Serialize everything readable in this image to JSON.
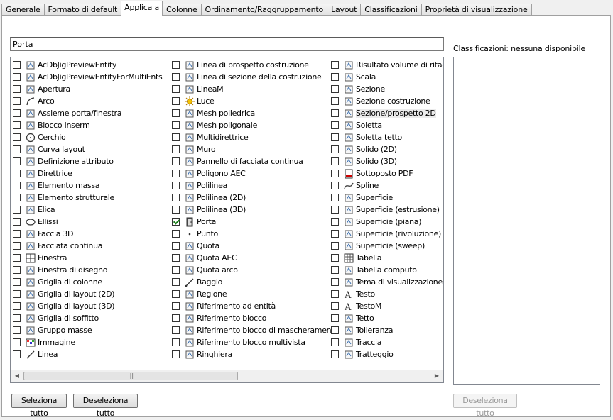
{
  "tabs": [
    {
      "label": "Generale"
    },
    {
      "label": "Formato di default"
    },
    {
      "label": "Applica a",
      "active": true
    },
    {
      "label": "Colonne"
    },
    {
      "label": "Ordinamento/Raggruppamento"
    },
    {
      "label": "Layout"
    },
    {
      "label": "Classificazioni"
    },
    {
      "label": "Proprietà di visualizzazione"
    }
  ],
  "filter": {
    "value": "Porta"
  },
  "classifications": {
    "label": "Classificazioni: nessuna disponibile"
  },
  "objects": {
    "col1": [
      {
        "label": "AcDbJigPreviewEntity",
        "icon": "document-icon"
      },
      {
        "label": "AcDbJigPreviewEntityForMultiEnts",
        "icon": "document-icon"
      },
      {
        "label": "Apertura",
        "icon": "opening-icon"
      },
      {
        "label": "Arco",
        "icon": "arc-icon"
      },
      {
        "label": "Assieme porta/finestra",
        "icon": "door-window-assembly-icon"
      },
      {
        "label": "Blocco Inserm",
        "icon": "block-icon"
      },
      {
        "label": "Cerchio",
        "icon": "circle-icon"
      },
      {
        "label": "Curva layout",
        "icon": "layout-curve-icon"
      },
      {
        "label": "Definizione attributo",
        "icon": "attribute-tag-icon"
      },
      {
        "label": "Direttrice",
        "icon": "direction-icon"
      },
      {
        "label": "Elemento massa",
        "icon": "mass-element-icon"
      },
      {
        "label": "Elemento strutturale",
        "icon": "structural-member-icon"
      },
      {
        "label": "Elica",
        "icon": "helix-icon"
      },
      {
        "label": "Ellissi",
        "icon": "ellipse-icon"
      },
      {
        "label": "Faccia 3D",
        "icon": "face-3d-icon"
      },
      {
        "label": "Facciata continua",
        "icon": "curtain-wall-icon"
      },
      {
        "label": "Finestra",
        "icon": "window-icon"
      },
      {
        "label": "Finestra di disegno",
        "icon": "viewport-icon"
      },
      {
        "label": "Griglia di colonne",
        "icon": "column-grid-icon"
      },
      {
        "label": "Griglia di layout (2D)",
        "icon": "grid-2d-icon"
      },
      {
        "label": "Griglia di layout (3D)",
        "icon": "grid-3d-icon"
      },
      {
        "label": "Griglia di soffitto",
        "icon": "ceiling-grid-icon"
      },
      {
        "label": "Gruppo masse",
        "icon": "mass-group-icon"
      },
      {
        "label": "Immagine",
        "icon": "image-icon"
      },
      {
        "label": "Linea",
        "icon": "line-icon"
      }
    ],
    "col2": [
      {
        "label": "Linea di prospetto costruzione",
        "icon": "elevation-line-icon"
      },
      {
        "label": "Linea di sezione della costruzione",
        "icon": "section-line-icon"
      },
      {
        "label": "LineaM",
        "icon": "mline-icon"
      },
      {
        "label": "Luce",
        "icon": "light-icon"
      },
      {
        "label": "Mesh poliedrica",
        "icon": "polyface-mesh-icon"
      },
      {
        "label": "Mesh poligonale",
        "icon": "polygon-mesh-icon"
      },
      {
        "label": "Multidirettrice",
        "icon": "multileader-icon"
      },
      {
        "label": "Muro",
        "icon": "wall-icon"
      },
      {
        "label": "Pannello di facciata continua",
        "icon": "curtain-panel-icon"
      },
      {
        "label": "Poligono AEC",
        "icon": "polygon-icon"
      },
      {
        "label": "Polilinea",
        "icon": "polyline-icon"
      },
      {
        "label": "Polilinea (2D)",
        "icon": "polyline-2d-icon"
      },
      {
        "label": "Polilinea (3D)",
        "icon": "polyline-3d-icon"
      },
      {
        "label": "Porta",
        "icon": "door-icon",
        "checked": true
      },
      {
        "label": "Punto",
        "icon": "point-icon"
      },
      {
        "label": "Quota",
        "icon": "dimension-icon"
      },
      {
        "label": "Quota AEC",
        "icon": "aec-dimension-icon"
      },
      {
        "label": "Quota arco",
        "icon": "arc-dimension-icon"
      },
      {
        "label": "Raggio",
        "icon": "ray-icon"
      },
      {
        "label": "Regione",
        "icon": "region-icon"
      },
      {
        "label": "Riferimento ad entità",
        "icon": "entity-reference-icon"
      },
      {
        "label": "Riferimento blocco",
        "icon": "block-reference-icon"
      },
      {
        "label": "Riferimento blocco di mascheramento",
        "icon": "masking-block-icon"
      },
      {
        "label": "Riferimento blocco multivista",
        "icon": "multiview-block-icon"
      },
      {
        "label": "Ringhiera",
        "icon": "railing-icon"
      }
    ],
    "col3": [
      {
        "label": "Risultato volume di ritaglio",
        "icon": "clip-volume-icon"
      },
      {
        "label": "Scala",
        "icon": "stair-icon"
      },
      {
        "label": "Sezione",
        "icon": "section-icon"
      },
      {
        "label": "Sezione costruzione",
        "icon": "building-section-icon"
      },
      {
        "label": "Sezione/prospetto 2D",
        "icon": "section-elevation-2d-icon",
        "highlight": true
      },
      {
        "label": "Soletta",
        "icon": "slab-icon"
      },
      {
        "label": "Soletta tetto",
        "icon": "roof-slab-icon"
      },
      {
        "label": "Solido (2D)",
        "icon": "solid-2d-icon"
      },
      {
        "label": "Solido (3D)",
        "icon": "solid-3d-icon"
      },
      {
        "label": "Sottoposto PDF",
        "icon": "pdf-underlay-icon"
      },
      {
        "label": "Spline",
        "icon": "spline-icon"
      },
      {
        "label": "Superficie",
        "icon": "surface-icon"
      },
      {
        "label": "Superficie (estrusione)",
        "icon": "surface-extrusion-icon"
      },
      {
        "label": "Superficie (piana)",
        "icon": "surface-planar-icon"
      },
      {
        "label": "Superficie (rivoluzione)",
        "icon": "surface-revolve-icon"
      },
      {
        "label": "Superficie (sweep)",
        "icon": "surface-sweep-icon"
      },
      {
        "label": "Tabella",
        "icon": "table-icon"
      },
      {
        "label": "Tabella computo",
        "icon": "schedule-table-icon"
      },
      {
        "label": "Tema di visualizzazione",
        "icon": "display-theme-icon"
      },
      {
        "label": "Testo",
        "icon": "text-icon"
      },
      {
        "label": "TestoM",
        "icon": "mtext-icon"
      },
      {
        "label": "Tetto",
        "icon": "roof-icon"
      },
      {
        "label": "Tolleranza",
        "icon": "tolerance-icon"
      },
      {
        "label": "Traccia",
        "icon": "trace-icon"
      },
      {
        "label": "Tratteggio",
        "icon": "hatch-icon"
      }
    ]
  },
  "buttons": {
    "select_all": "Seleziona tutto",
    "deselect_all": "Deseleziona tutto",
    "class_deselect_all": "Deseleziona tutto"
  }
}
